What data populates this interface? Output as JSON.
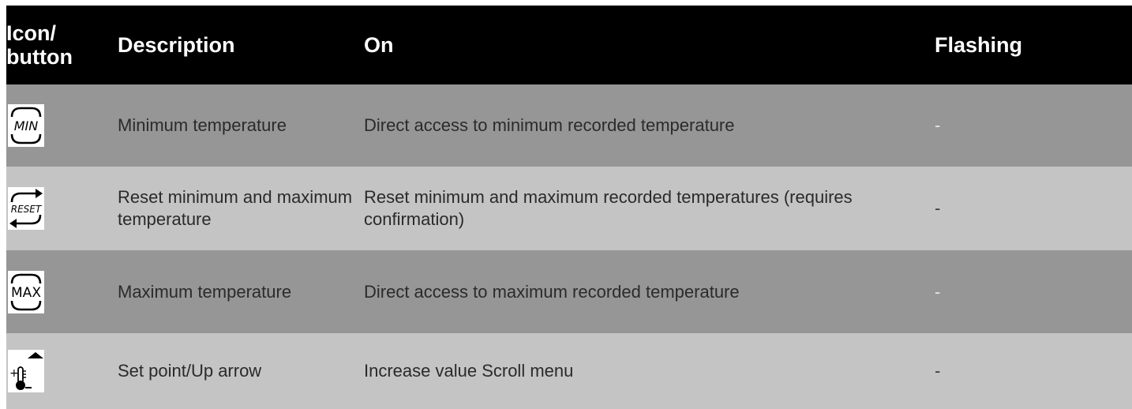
{
  "table": {
    "headers": {
      "icon": "Icon/ button",
      "description": "Description",
      "on": "On",
      "flashing": "Flashing"
    },
    "rows": [
      {
        "icon_name": "min-icon",
        "icon_text": "MIN",
        "description": "Minimum temperature",
        "on": "Direct access to minimum recorded temperature",
        "flashing": "-"
      },
      {
        "icon_name": "reset-icon",
        "icon_text": "RESET",
        "description": "Reset minimum and maximum temperature",
        "on": "Reset minimum and maximum recorded temperatures (requires confirmation)",
        "flashing": "-"
      },
      {
        "icon_name": "max-icon",
        "icon_text": "MAX",
        "description": "Maximum temperature",
        "on": "Direct access to maximum recorded temperature",
        "flashing": "-"
      },
      {
        "icon_name": "setpoint-up-arrow-icon",
        "icon_text": "",
        "description": "Set point/Up arrow",
        "on": "Increase value Scroll menu",
        "flashing": "-"
      }
    ]
  },
  "colors": {
    "header_bg": "#000000",
    "row_dark": "#969696",
    "row_light": "#c4c4c4"
  }
}
